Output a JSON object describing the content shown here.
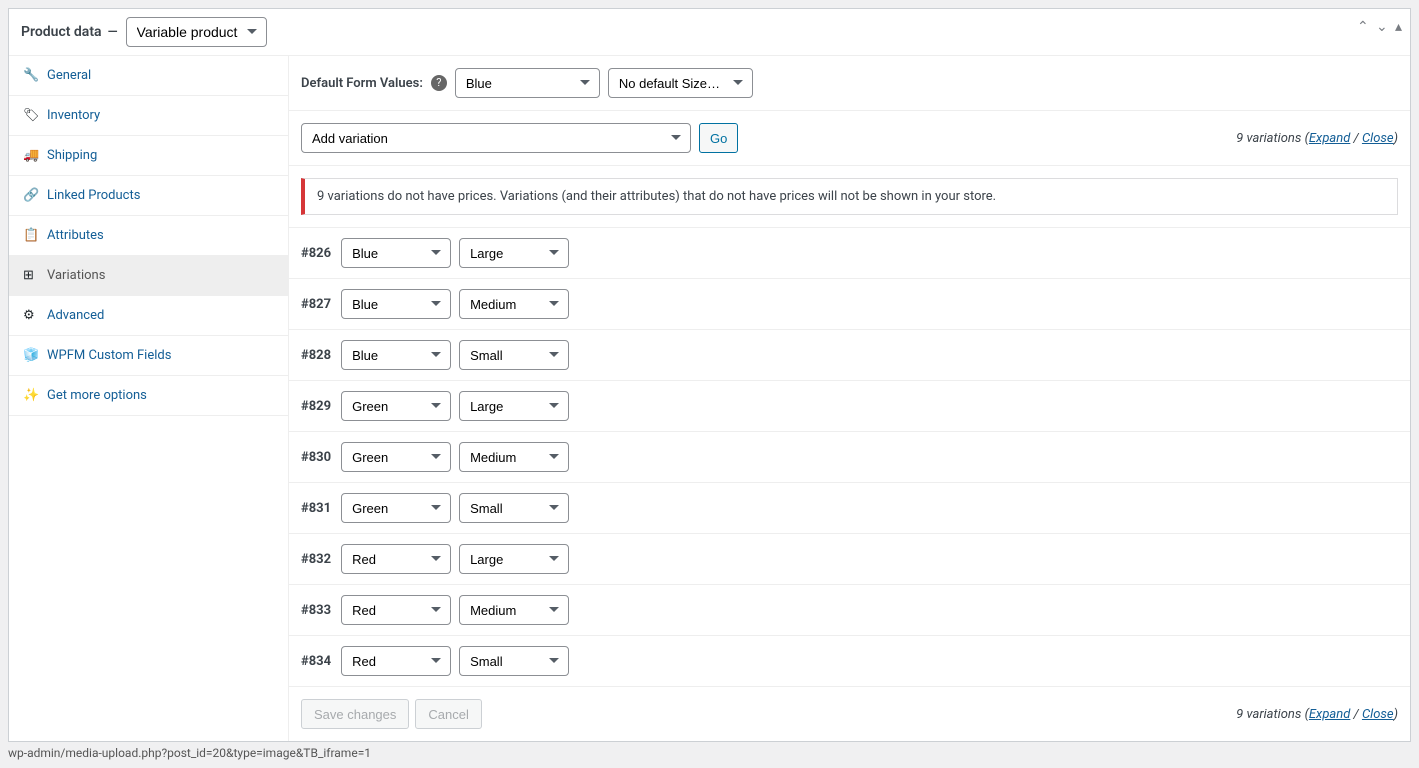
{
  "header": {
    "title": "Product data",
    "sep": "—",
    "product_type": "Variable product"
  },
  "tabs": [
    {
      "icon": "wrench",
      "label": "General"
    },
    {
      "icon": "tag",
      "label": "Inventory"
    },
    {
      "icon": "truck",
      "label": "Shipping"
    },
    {
      "icon": "link",
      "label": "Linked Products"
    },
    {
      "icon": "list",
      "label": "Attributes"
    },
    {
      "icon": "grid",
      "label": "Variations",
      "active": true
    },
    {
      "icon": "gear",
      "label": "Advanced"
    },
    {
      "icon": "cube",
      "label": "WPFM Custom Fields"
    },
    {
      "icon": "wand",
      "label": "Get more options"
    }
  ],
  "defaults": {
    "label": "Default Form Values:",
    "color": "Blue",
    "size": "No default Size…"
  },
  "actions": {
    "add_variation": "Add variation",
    "go": "Go",
    "count_text": "9 variations",
    "expand": "Expand",
    "close": "Close"
  },
  "notice": "9 variations do not have prices. Variations (and their attributes) that do not have prices will not be shown in your store.",
  "variations": [
    {
      "id": "#826",
      "color": "Blue",
      "size": "Large"
    },
    {
      "id": "#827",
      "color": "Blue",
      "size": "Medium"
    },
    {
      "id": "#828",
      "color": "Blue",
      "size": "Small"
    },
    {
      "id": "#829",
      "color": "Green",
      "size": "Large"
    },
    {
      "id": "#830",
      "color": "Green",
      "size": "Medium"
    },
    {
      "id": "#831",
      "color": "Green",
      "size": "Small"
    },
    {
      "id": "#832",
      "color": "Red",
      "size": "Large"
    },
    {
      "id": "#833",
      "color": "Red",
      "size": "Medium"
    },
    {
      "id": "#834",
      "color": "Red",
      "size": "Small"
    }
  ],
  "footer": {
    "save": "Save changes",
    "cancel": "Cancel"
  },
  "options": {
    "colors": [
      "Blue",
      "Green",
      "Red"
    ],
    "sizes": [
      "Large",
      "Medium",
      "Small"
    ]
  },
  "status_bar": "wp-admin/media-upload.php?post_id=20&type=image&TB_iframe=1"
}
